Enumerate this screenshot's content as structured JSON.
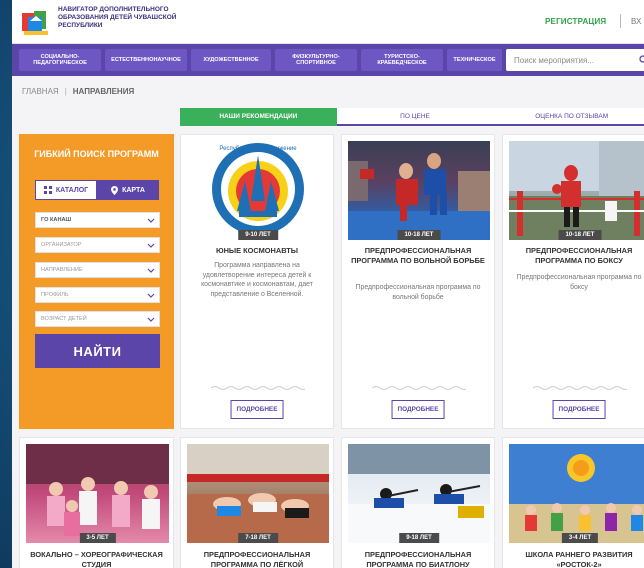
{
  "header": {
    "site_title": "НАВИГАТОР ДОПОЛНИТЕЛЬНОГО ОБРАЗОВАНИЯ ДЕТЕЙ ЧУВАШСКОЙ РЕСПУБЛИКИ",
    "register": "РЕГИСТРАЦИЯ",
    "login": "ВХ"
  },
  "nav": {
    "items": [
      "СОЦИАЛЬНО-ПЕДАГОГИЧЕСКОЕ",
      "ЕСТЕСТВЕННОНАУЧНОЕ",
      "ХУДОЖЕСТВЕННОЕ",
      "ФИЗКУЛЬТУРНО-СПОРТИВНОЕ",
      "ТУРИСТСКО-КРАЕВЕДЧЕСКОЕ",
      "ТЕХНИЧЕСКОЕ"
    ],
    "search_placeholder": "Поиск мероприятия..."
  },
  "breadcrumb": {
    "home": "ГЛАВНАЯ",
    "current": "НАПРАВЛЕНИЯ"
  },
  "tabs": [
    "НАШИ РЕКОМЕНДАЦИИ",
    "ПО ЦЕНЕ",
    "ОЦЕНКА ПО ОТЗЫВАМ"
  ],
  "filter": {
    "title": "ГИБКИЙ ПОИСК ПРОГРАММ",
    "catalog": "КАТАЛОГ",
    "map": "КАРТА",
    "city": "ГО КАНАШ",
    "organizer": "ОРГАНИЗАТОР",
    "direction": "НАПРАВЛЕНИЕ",
    "profile": "ПРОФИЛЬ",
    "age": "ВОЗРАСТ ДЕТЕЙ",
    "find": "НАЙТИ"
  },
  "more_label": "ПОДРОБНЕЕ",
  "cards": [
    {
      "age": "9-10 ЛЕТ",
      "title": "ЮНЫЕ КОСМОНАВТЫ",
      "desc": "Программа направлена на удовлетворение интереса детей к космонавтике и космонавтам, дает представление о Вселенной.",
      "logo_text": "Республиканское движение"
    },
    {
      "age": "10-18 ЛЕТ",
      "title": "ПРЕДПРОФЕССИОНАЛЬНАЯ ПРОГРАММА ПО ВОЛЬНОЙ БОРЬБЕ",
      "desc": "Предпрофессиональная программа по вольной борьбе"
    },
    {
      "age": "10-18 ЛЕТ",
      "title": "ПРЕДПРОФЕССИОНАЛЬНАЯ ПРОГРАММА ПО БОКСУ",
      "desc": "Предпрофессиональная программа по боксу"
    }
  ],
  "cards2": [
    {
      "age": "3-5 ЛЕТ",
      "title": "ВОКАЛЬНО – ХОРЕОГРАФИЧЕСКАЯ СТУДИЯ"
    },
    {
      "age": "7-18 ЛЕТ",
      "title": "ПРЕДПРОФЕССИОНАЛЬНАЯ ПРОГРАММА ПО ЛЁГКОЙ"
    },
    {
      "age": "9-18 ЛЕТ",
      "title": "ПРЕДПРОФЕССИОНАЛЬНАЯ ПРОГРАММА ПО БИАТЛОНУ"
    },
    {
      "age": "3-4 ЛЕТ",
      "title": "ШКОЛА РАННЕГО РАЗВИТИЯ «РОСТОК-2»"
    }
  ],
  "colors": {
    "brand_purple": "#5b45a8",
    "accent_orange": "#f39a27",
    "accent_green": "#3bb05a"
  }
}
